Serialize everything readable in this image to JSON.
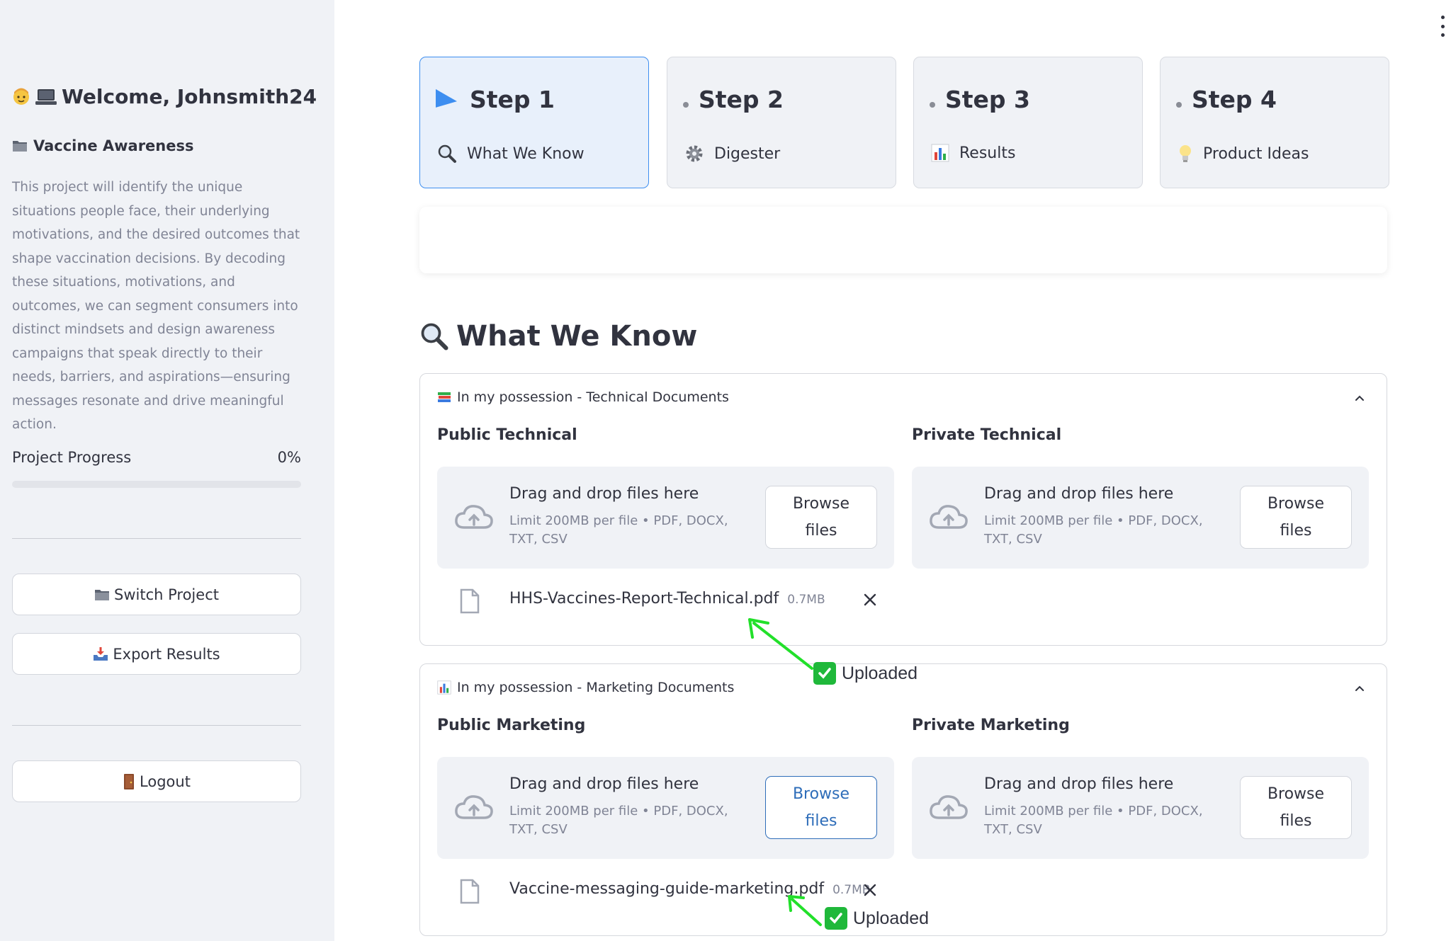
{
  "sidebar": {
    "welcome": "Welcome, Johnsmith24",
    "project_name": "Vaccine Awareness",
    "project_description": "This project will identify the unique situations people face, their underlying motivations, and the desired outcomes that shape vaccination decisions. By decoding these situations, motivations, and outcomes, we can segment consumers into distinct mindsets and design awareness campaigns that speak directly to their needs, barriers, and aspirations—ensuring messages resonate and drive meaningful action.",
    "progress_label": "Project Progress",
    "progress_value": "0%",
    "progress_fraction": 0,
    "switch_project": "Switch Project",
    "export_results": "Export Results",
    "logout": "Logout"
  },
  "steps": [
    {
      "title": "Step 1",
      "label": "What We Know",
      "icon": "magnifier-icon",
      "active": true
    },
    {
      "title": "Step 2",
      "label": "Digester",
      "icon": "gear-icon",
      "active": false
    },
    {
      "title": "Step 3",
      "label": "Results",
      "icon": "bar-chart-icon",
      "active": false
    },
    {
      "title": "Step 4",
      "label": "Product Ideas",
      "icon": "lightbulb-icon",
      "active": false
    }
  ],
  "main": {
    "section_title": "What We Know"
  },
  "technical": {
    "header": "In my possession - Technical Documents",
    "public_label": "Public Technical",
    "private_label": "Private Technical",
    "file_name": "HHS-Vaccines-Report-Technical.pdf",
    "file_size": "0.7MB"
  },
  "marketing": {
    "header": "In my possession - Marketing Documents",
    "public_label": "Public Marketing",
    "private_label": "Private Marketing",
    "file_name": "Vaccine-messaging-guide-marketing.pdf",
    "file_size": "0.7MB"
  },
  "uploader": {
    "drag_text": "Drag and drop files here",
    "limit_text": "Limit 200MB per file • PDF, DOCX, TXT, CSV",
    "browse_line1": "Browse",
    "browse_line2": "files"
  },
  "annotations": {
    "uploaded": "Uploaded",
    "color": "#22e02a"
  },
  "colors": {
    "accent": "#3d8ef0",
    "sidebar_bg": "#f0f2f6",
    "active_step_bg": "#e8f0fb",
    "check_green": "#1fb83a"
  }
}
